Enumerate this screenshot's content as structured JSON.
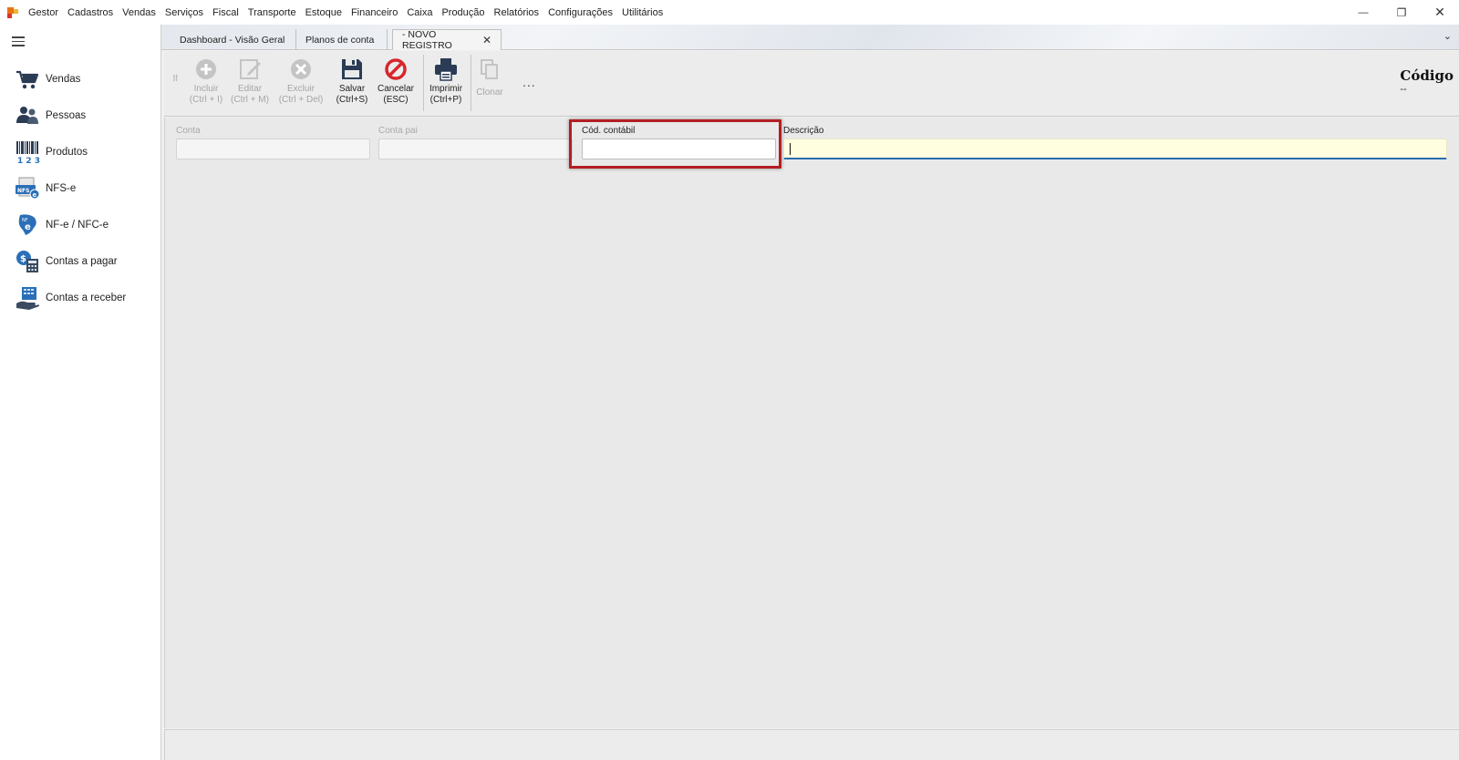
{
  "menu": {
    "items": [
      "Gestor",
      "Cadastros",
      "Vendas",
      "Serviços",
      "Fiscal",
      "Transporte",
      "Estoque",
      "Financeiro",
      "Caixa",
      "Produção",
      "Relatórios",
      "Configurações",
      "Utilitários"
    ]
  },
  "window": {
    "minimize": "—",
    "restore": "❐",
    "close": "✕"
  },
  "sidebar": {
    "items": [
      {
        "label": "Vendas",
        "icon": "shopping-cart-icon"
      },
      {
        "label": "Pessoas",
        "icon": "people-icon"
      },
      {
        "label": "Produtos",
        "icon": "barcode-icon"
      },
      {
        "label": "NFS-e",
        "icon": "nfse-icon"
      },
      {
        "label": "NF-e / NFC-e",
        "icon": "nfe-icon"
      },
      {
        "label": "Contas a pagar",
        "icon": "accounts-payable-icon"
      },
      {
        "label": "Contas a receber",
        "icon": "accounts-receivable-icon"
      }
    ]
  },
  "tabs": [
    {
      "label": "Dashboard - Visão Geral",
      "active": false
    },
    {
      "label": "Planos de conta",
      "active": false
    },
    {
      "label": "- NOVO REGISTRO",
      "active": true
    }
  ],
  "tab_close": "✕",
  "tab_chevron": "⌄",
  "toolbar": {
    "incluir": {
      "label": "Incluir",
      "shortcut": "(Ctrl + I)",
      "enabled": false
    },
    "editar": {
      "label": "Editar",
      "shortcut": "(Ctrl + M)",
      "enabled": false
    },
    "excluir": {
      "label": "Excluir",
      "shortcut": "(Ctrl + Del)",
      "enabled": false
    },
    "salvar": {
      "label": "Salvar",
      "shortcut": "(Ctrl+S)",
      "enabled": true
    },
    "cancelar": {
      "label": "Cancelar",
      "shortcut": "(ESC)",
      "enabled": true
    },
    "imprimir": {
      "label": "Imprimir",
      "shortcut": "(Ctrl+P)",
      "enabled": true
    },
    "clonar": {
      "label": "Clonar",
      "enabled": false
    },
    "more": "..."
  },
  "codigo": {
    "title": "Código",
    "value": "--"
  },
  "form": {
    "conta": {
      "label": "Conta",
      "value": ""
    },
    "conta_pai": {
      "label": "Conta pai",
      "value": ""
    },
    "cod_contabil": {
      "label": "Cód. contábil",
      "value": ""
    },
    "descricao": {
      "label": "Descrição",
      "value": ""
    }
  },
  "colors": {
    "highlight": "#b31f24",
    "focus_bg": "#ffffe0",
    "focus_border": "#2b6cb0",
    "cancel_red": "#d8262c"
  }
}
